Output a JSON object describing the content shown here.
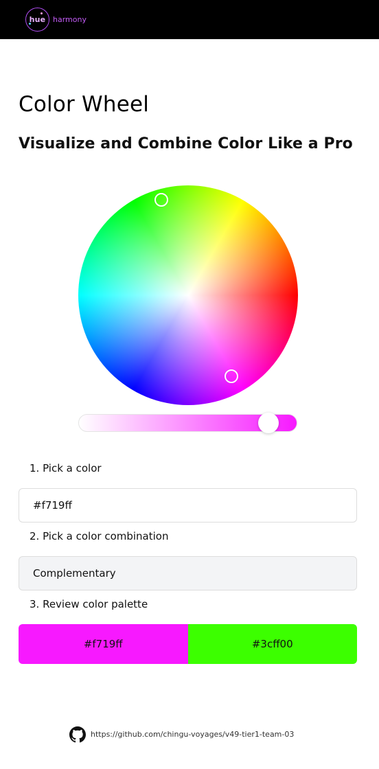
{
  "brand": {
    "logo_text": "hue",
    "name": "harmony",
    "colors": {
      "logo_ring": "#b04df2",
      "logo_text": "#e9b3ff",
      "name": "#c35cf6"
    }
  },
  "page": {
    "title": "Color Wheel",
    "subtitle": "Visualize and Combine Color Like a Pro"
  },
  "wheel": {
    "selected_color": "#f719ff",
    "complement_color": "#3cff00",
    "brightness_slider_value": 0.87
  },
  "steps": {
    "pick_color_label": "1. Pick a color",
    "hex_value": "#f719ff",
    "pick_combination_label": "2. Pick a color combination",
    "combination_value": "Complementary",
    "review_palette_label": "3. Review color palette"
  },
  "palette": [
    {
      "hex": "#f719ff",
      "label": "#f719ff"
    },
    {
      "hex": "#3cff00",
      "label": "#3cff00"
    }
  ],
  "footer": {
    "icon": "github-icon",
    "link_text": "https://github.com/chingu-voyages/v49-tier1-team-03"
  }
}
